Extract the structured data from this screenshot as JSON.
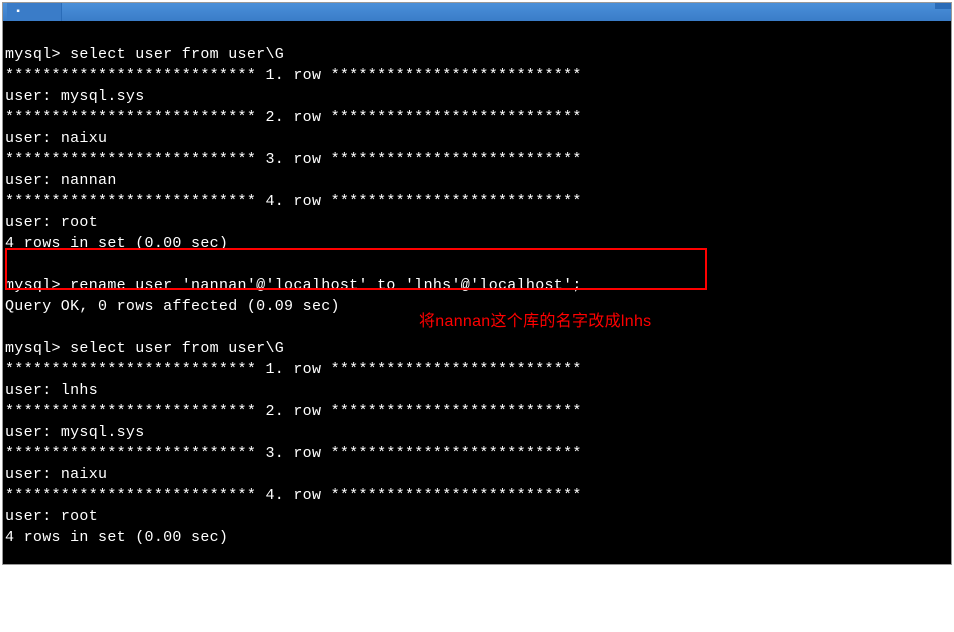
{
  "title_bar": {
    "tab_label": ""
  },
  "terminal": {
    "prompt": "mysql>",
    "query1": {
      "prompt": "mysql> ",
      "command": "select user from user\\G"
    },
    "row_separator_prefix": "*************************** ",
    "row_separator_suffix": ". row ***************************",
    "result1": {
      "rows": [
        {
          "num": "1",
          "user": "mysql.sys"
        },
        {
          "num": "2",
          "user": "naixu"
        },
        {
          "num": "3",
          "user": "nannan"
        },
        {
          "num": "4",
          "user": "root"
        }
      ],
      "summary": "4 rows in set (0.00 sec)"
    },
    "query2": {
      "prompt": "mysql> ",
      "command": "rename user 'nannan'@'localhost' to 'lnhs'@'localhost';"
    },
    "result2_summary": "Query OK, 0 rows affected (0.09 sec)",
    "query3": {
      "prompt": "mysql> ",
      "command": "select user from user\\G"
    },
    "result3": {
      "rows": [
        {
          "num": "1",
          "user": "lnhs"
        },
        {
          "num": "2",
          "user": "mysql.sys"
        },
        {
          "num": "3",
          "user": "naixu"
        },
        {
          "num": "4",
          "user": "root"
        }
      ],
      "summary": "4 rows in set (0.00 sec)"
    },
    "user_label": "user: "
  },
  "annotation": {
    "text": "将nannan这个库的名字改成lnhs"
  }
}
